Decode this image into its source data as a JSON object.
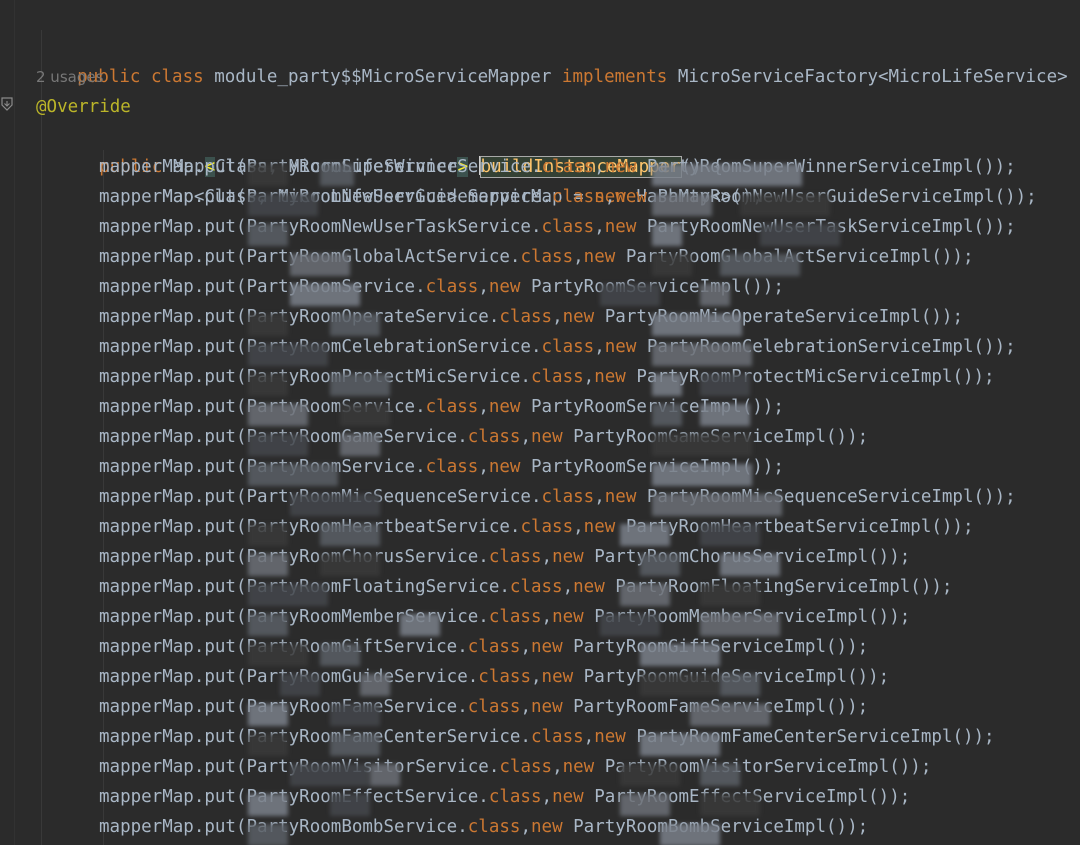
{
  "editor": {
    "header": {
      "kw_public": "public",
      "kw_class": "class",
      "class_name": "module_party$$MicroServiceMapper",
      "kw_implements": "implements",
      "interface": "MicroServiceFactory<MicroLifeService>",
      "brace": "{"
    },
    "usages_hint": "2 usages",
    "annotation": "@Override",
    "method": {
      "kw_public": "public",
      "ret_type_start": "Map",
      "lt": "<",
      "ret_type_mid": "Class, MicroLifeService",
      "gt": ">",
      "name": "buildInstanceMapper",
      "params": "() {"
    },
    "decl": {
      "text_a": "Map<Class, MicroLifeService> mapperMap = ",
      "kw_new": "new",
      "text_b": " HashMap<>();"
    },
    "put_lines": [
      {
        "before": "mapperMap.put(PartyRoomSuperWinnerService.",
        "mid": ",",
        "after": " PartyRoomSuperWinnerServiceImpl());"
      },
      {
        "before": "mapperMap.put(PartyRoomNewUserGuideService.",
        "mid": ",",
        "after": " PartyRoomNewUserGuideServiceImpl());"
      },
      {
        "before": "mapperMap.put(PartyRoomNewUserTaskService.",
        "mid": ",",
        "after": " PartyRoomNewUserTaskServiceImpl());"
      },
      {
        "before": "mapperMap.put(PartyRoomGlobalActService.",
        "mid": ",",
        "after": " PartyRoomGlobalActServiceImpl());"
      },
      {
        "before": "mapperMap.put(PartyRoomService.",
        "mid": ",",
        "after": " PartyRoomServiceImpl());"
      },
      {
        "before": "mapperMap.put(PartyRoomOperateService.",
        "mid": ",",
        "after": " PartyRoomMicOperateServiceImpl());"
      },
      {
        "before": "mapperMap.put(PartyRoomCelebrationService.",
        "mid": ",",
        "after": " PartyRoomCelebrationServiceImpl());"
      },
      {
        "before": "mapperMap.put(PartyRoomProtectMicService.",
        "mid": ",",
        "after": " PartyRoomProtectMicServiceImpl());"
      },
      {
        "before": "mapperMap.put(PartyRoomService.",
        "mid": ",",
        "after": " PartyRoomServiceImpl());"
      },
      {
        "before": "mapperMap.put(PartyRoomGameService.",
        "mid": ",",
        "after": " PartyRoomGameServiceImpl());"
      },
      {
        "before": "mapperMap.put(PartyRoomService.",
        "mid": ",",
        "after": " PartyRoomServiceImpl());"
      },
      {
        "before": "mapperMap.put(PartyRoomMicSequenceService.",
        "mid": ",",
        "after": " PartyRoomMicSequenceServiceImpl());"
      },
      {
        "before": "mapperMap.put(PartyRoomHeartbeatService.",
        "mid": ",",
        "after": " PartyRoomHeartbeatServiceImpl());"
      },
      {
        "before": "mapperMap.put(PartyRoomChorusService.",
        "mid": ",",
        "after": " PartyRoomChorusServiceImpl());"
      },
      {
        "before": "mapperMap.put(PartyRoomFloatingService.",
        "mid": ",",
        "after": " PartyRoomFloatingServiceImpl());"
      },
      {
        "before": "mapperMap.put(PartyRoomMemberService.",
        "mid": ",",
        "after": " PartyRoomMemberServiceImpl());"
      },
      {
        "before": "mapperMap.put(PartyRoomGiftService.",
        "mid": ",",
        "after": " PartyRoomGiftServiceImpl());"
      },
      {
        "before": "mapperMap.put(PartyRoomGuideService.",
        "mid": ",",
        "after": " PartyRoomGuideServiceImpl());"
      },
      {
        "before": "mapperMap.put(PartyRoomFameService.",
        "mid": ",",
        "after": " PartyRoomFameServiceImpl());"
      },
      {
        "before": "mapperMap.put(PartyRoomFameCenterService.",
        "mid": ",",
        "after": " PartyRoomFameCenterServiceImpl());"
      },
      {
        "before": "mapperMap.put(PartyRoomVisitorService.",
        "mid": ",",
        "after": " PartyRoomVisitorServiceImpl());"
      },
      {
        "before": "mapperMap.put(PartyRoomEffectService.",
        "mid": ",",
        "after": " PartyRoomEffectServiceImpl());"
      },
      {
        "before": "mapperMap.put(PartyRoomBombService.",
        "mid": ",",
        "after": " PartyRoomBombServiceImpl());"
      }
    ],
    "kw_class_token": "class",
    "kw_new_token": "new"
  },
  "colors": {
    "background": "#2b2b2b",
    "keyword": "#cc7832",
    "text": "#a9b7c6",
    "annotation": "#bbb529",
    "method_declaration": "#ffc66d",
    "hint": "#787878"
  },
  "icons": {
    "gutter": "override-method-icon"
  }
}
